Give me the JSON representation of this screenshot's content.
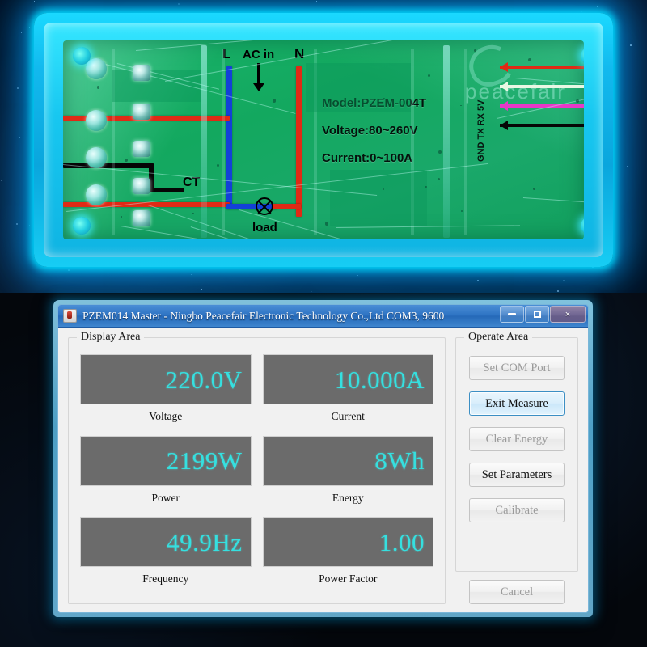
{
  "photo": {
    "device_labels": {
      "line": "L",
      "neutral": "N",
      "ac_in": "AC in",
      "ct": "CT",
      "load": "load"
    },
    "silkscreen": {
      "model": "Model:PZEM-004T",
      "voltage": "Voltage:80~260V",
      "current": "Current:0~100A",
      "pins": "GND TX RX 5V"
    },
    "brand": "peacefair",
    "colors": {
      "case_glow": "#0ad4ff",
      "pcb_green": "#16a862",
      "wire_live": "#1340d8",
      "wire_neutral": "#e02a15",
      "wire_ct": "#050505"
    }
  },
  "window": {
    "title": "PZEM014 Master - Ningbo Peacefair Electronic Technology Co.,Ltd  COM3, 9600",
    "icon": "app-icon",
    "controls": {
      "minimize": "minimize-icon",
      "maximize": "maximize-icon",
      "close": "×"
    }
  },
  "display_area": {
    "title": "Display Area",
    "accent_color": "#35e0e0",
    "panel_color": "#6b6b6b",
    "meters": [
      {
        "label": "Voltage",
        "value": "220.0V"
      },
      {
        "label": "Current",
        "value": "10.000A"
      },
      {
        "label": "Power",
        "value": "2199W"
      },
      {
        "label": "Energy",
        "value": "8Wh"
      },
      {
        "label": "Frequency",
        "value": "49.9Hz"
      },
      {
        "label": "Power Factor",
        "value": "1.00"
      }
    ]
  },
  "operate_area": {
    "title": "Operate Area",
    "buttons": [
      {
        "label": "Set COM Port",
        "state": "disabled"
      },
      {
        "label": "Exit Measure",
        "state": "focused"
      },
      {
        "label": "Clear Energy",
        "state": "disabled"
      },
      {
        "label": "Set Parameters",
        "state": "enabled"
      },
      {
        "label": "Calibrate",
        "state": "disabled"
      }
    ],
    "cancel": {
      "label": "Cancel",
      "state": "disabled"
    }
  }
}
